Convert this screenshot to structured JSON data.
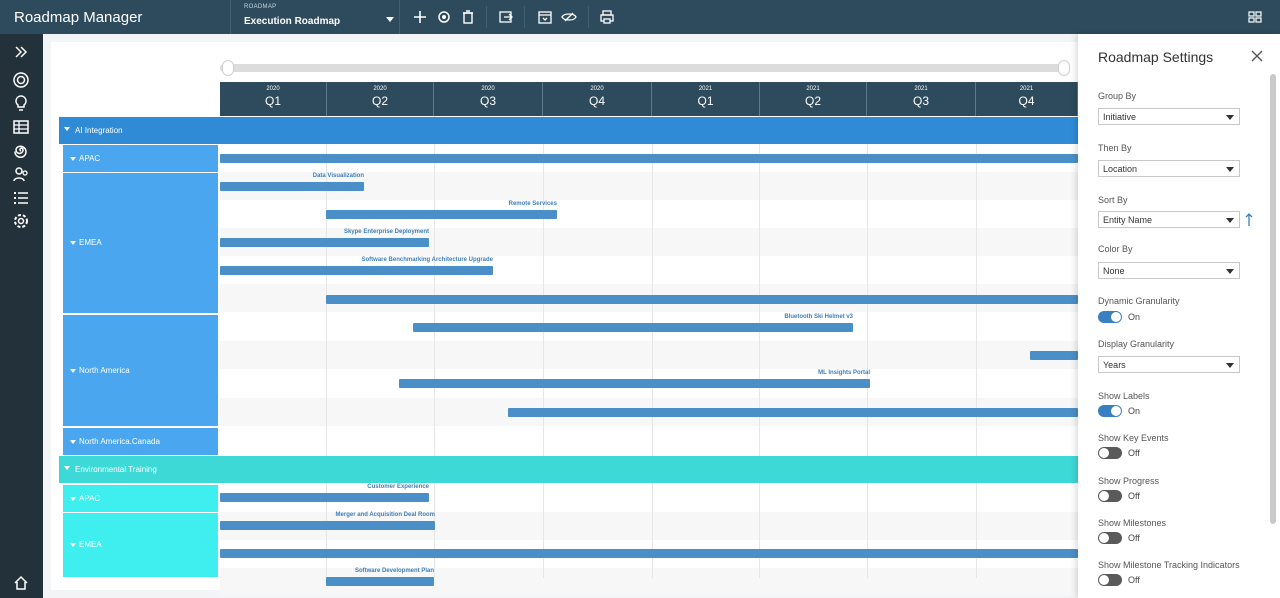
{
  "app": {
    "title": "Roadmap Manager"
  },
  "roadmap": {
    "label": "ROADMAP",
    "name": "Execution Roadmap"
  },
  "toolbar": {
    "icons": [
      "plus-icon",
      "gear-icon",
      "trash-icon",
      "export-icon",
      "calendar-icon",
      "view-icon",
      "print-icon",
      "grid-icon"
    ]
  },
  "nav": {
    "icons": [
      "expand-icon",
      "target-icon",
      "lightbulb-icon",
      "table-icon",
      "spiral-icon",
      "people-icon",
      "list-icon",
      "settings-icon",
      "home-icon"
    ]
  },
  "timeline": {
    "quarters": [
      {
        "year": "2020",
        "q": "Q1"
      },
      {
        "year": "2020",
        "q": "Q2"
      },
      {
        "year": "2020",
        "q": "Q3"
      },
      {
        "year": "2020",
        "q": "Q4"
      },
      {
        "year": "2021",
        "q": "Q1"
      },
      {
        "year": "2021",
        "q": "Q2"
      },
      {
        "year": "2021",
        "q": "Q3"
      },
      {
        "year": "2021",
        "q": "Q4"
      }
    ]
  },
  "initiatives": [
    {
      "name": "AI Integration",
      "color": "#2f8bd6"
    },
    {
      "name": "Environmental Training",
      "color": "#3dd9d6"
    }
  ],
  "groups": [
    {
      "name": "APAC",
      "color": "#4aa6ee"
    },
    {
      "name": "EMEA",
      "color": "#4aa6ee"
    },
    {
      "name": "North America",
      "color": "#4aa6ee"
    },
    {
      "name": "North America.Canada",
      "color": "#4aa6ee"
    },
    {
      "name": "APAC",
      "color": "#3feff0"
    },
    {
      "name": "EMEA",
      "color": "#3feff0"
    }
  ],
  "bars": [
    {
      "label": ""
    },
    {
      "label": "Data Visualization"
    },
    {
      "label": "Remote Services"
    },
    {
      "label": "Skype Enterprise Deployment"
    },
    {
      "label": "Software Benchmarking Architecture Upgrade"
    },
    {
      "label": ""
    },
    {
      "label": "Bluetooth Ski Helmet v3"
    },
    {
      "label": ""
    },
    {
      "label": "ML Insights Portal"
    },
    {
      "label": ""
    },
    {
      "label": "Customer Experience"
    },
    {
      "label": "Merger and Acquisition Deal Room"
    },
    {
      "label": ""
    },
    {
      "label": "Software Development Plan"
    }
  ],
  "settings": {
    "title": "Roadmap Settings",
    "group_by": {
      "label": "Group By",
      "value": "Initiative"
    },
    "then_by": {
      "label": "Then By",
      "value": "Location"
    },
    "sort_by": {
      "label": "Sort By",
      "value": "Entity Name"
    },
    "color_by": {
      "label": "Color By",
      "value": "None"
    },
    "dynamic_granularity": {
      "label": "Dynamic Granularity",
      "state": "On"
    },
    "display_granularity": {
      "label": "Display Granularity",
      "value": "Years"
    },
    "show_labels": {
      "label": "Show Labels",
      "state": "On"
    },
    "show_key_events": {
      "label": "Show Key Events",
      "state": "Off"
    },
    "show_progress": {
      "label": "Show Progress",
      "state": "Off"
    },
    "show_milestones": {
      "label": "Show Milestones",
      "state": "Off"
    },
    "show_milestone_tracking": {
      "label": "Show Milestone Tracking Indicators",
      "state": "Off"
    }
  }
}
